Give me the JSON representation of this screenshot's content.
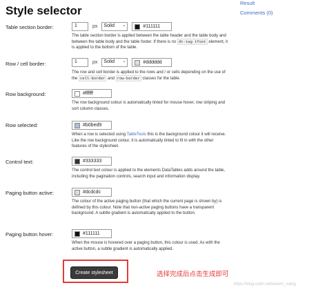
{
  "page": {
    "title": "Style selector"
  },
  "side_links": {
    "result": "Result",
    "comments": "Comments (0)"
  },
  "rows": {
    "table_section_border": {
      "label": "Table section border:",
      "width": "1",
      "unit": "px",
      "style": "Solid",
      "color": "#111111",
      "swatch": "#111111",
      "desc_1": "The table section border is applied between the table header and the table body and between the table body and the table footer. If there is no ",
      "desc_code": "dt-tag tfoot",
      "desc_2": " element, it is applied to the bottom of the table."
    },
    "row_cell_border": {
      "label": "Row / cell border:",
      "width": "1",
      "unit": "px",
      "style": "Solid",
      "color": "#dddddd",
      "swatch": "#dddddd",
      "desc_1": "The row and cell border is applied to the rows and / or cells depending on the use of the ",
      "desc_code_1": "cell-border",
      "desc_mid": " and ",
      "desc_code_2": "row-border",
      "desc_2": " classes for the table."
    },
    "row_background": {
      "label": "Row background:",
      "color": "#ffffff",
      "swatch": "#ffffff",
      "desc": "The row background colour is automatically tinted for mouse hover, row striping and sort column classes."
    },
    "row_selected": {
      "label": "Row selected:",
      "color": "#b0bed9",
      "swatch": "#b0bed9",
      "desc_1": "When a row is selected using ",
      "desc_link": "TableTools",
      "desc_2": " this is the background colour it will receive. Like the row background colour, it is automatically tinted to fit in with the other features of the stylesheet."
    },
    "control_text": {
      "label": "Control text:",
      "color": "#333333",
      "swatch": "#333333",
      "desc": "The control text colour is applied to the elements DataTables adds around the table, including the pagination controls, search input and information display."
    },
    "paging_button_active": {
      "label": "Paging button active:",
      "color": "#dcdcdc",
      "swatch": "#dcdcdc",
      "desc": "The colour of the active paging button (that which the current page is shown by) is defined by this colour. Note that non-active paging buttons have a transparent background. A subtle gradient is automatically applied to the button."
    },
    "paging_button_hover": {
      "label": "Paging button hover:",
      "color": "#111111",
      "swatch": "#111111",
      "desc": "When the mouse is hovered over a paging button, this colour is used. As with the active button, a subtle gradient is automatically applied."
    }
  },
  "actions": {
    "create_label": "Create stylesheet"
  },
  "annotation": {
    "text": "选择完成后点击生成即可",
    "color": "#e53935"
  },
  "watermark": {
    "text": "https://blog.csdn.net/weixin_xiang"
  }
}
